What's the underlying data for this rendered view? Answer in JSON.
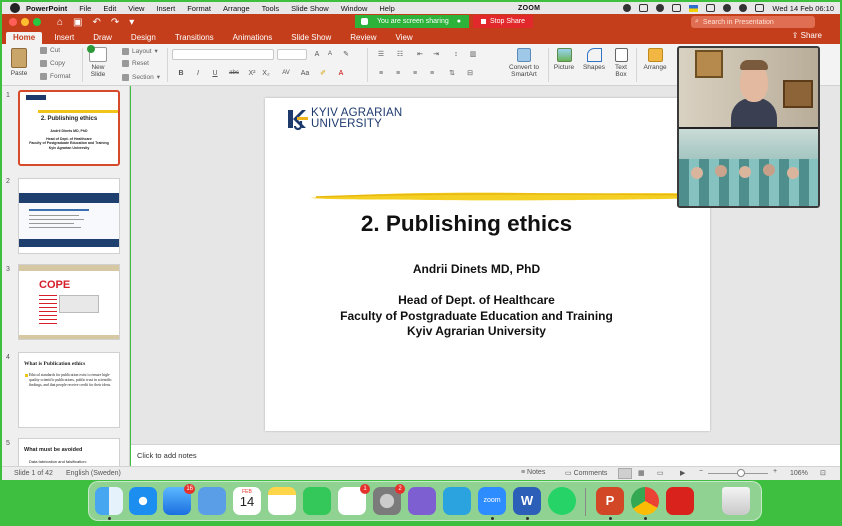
{
  "menubar": {
    "app": "PowerPoint",
    "items": [
      "File",
      "Edit",
      "View",
      "Insert",
      "Format",
      "Arrange",
      "Tools",
      "Slide Show",
      "Window",
      "Help"
    ],
    "zoom_label": "ZOOM",
    "clock": "Wed 14 Feb  06:10"
  },
  "titlebar": {
    "screen_sharing": "You are screen sharing",
    "stop_share": "Stop Share",
    "search_placeholder": "Search in Presentation"
  },
  "tabs": [
    "Home",
    "Insert",
    "Draw",
    "Design",
    "Transitions",
    "Animations",
    "Slide Show",
    "Review",
    "View"
  ],
  "active_tab": "Home",
  "share_label": "Share",
  "ribbon": {
    "paste": "Paste",
    "cut": "Cut",
    "copy": "Copy",
    "format": "Format",
    "new_slide": "New Slide",
    "layout": "Layout",
    "reset": "Reset",
    "section": "Section",
    "convert": "Convert to SmartArt",
    "picture": "Picture",
    "shapes": "Shapes",
    "text_box": "Text Box",
    "arrange": "Arrange",
    "bold": "B",
    "italic": "I",
    "underline": "U",
    "strike": "abc",
    "sup": "X²",
    "sub": "X₂",
    "char_spacing": "AV",
    "case": "Aa",
    "font_grow": "A",
    "font_shrink": "A"
  },
  "thumbnails": [
    {
      "number": "1",
      "title": "2. Publishing ethics",
      "lines": [
        "Andrii Dinets MD, PhD",
        "Head of Dept. of Healthcare",
        "Faculty of Postgraduate Education and Training",
        "Kyiv Agrarian University"
      ]
    },
    {
      "number": "2"
    },
    {
      "number": "3",
      "title": "COPE"
    },
    {
      "number": "4",
      "title": "What is Publication ethics",
      "body": "Ethical standards for publication exist to ensure high-quality scientific publications, public trust in scientific findings, and that people receive credit for their ideas."
    },
    {
      "number": "5",
      "title": "What must be avoided",
      "body": "Data fabrication and falsification:"
    }
  ],
  "slide": {
    "logo_line1": "KYIV AGRARIAN",
    "logo_line2": "UNIVERSITY",
    "title": "2. Publishing ethics",
    "author": "Andrii Dinets MD, PhD",
    "affiliation": [
      "Head of Dept. of Healthcare",
      "Faculty of Postgraduate Education and Training",
      "Kyiv Agrarian University"
    ]
  },
  "notes_placeholder": "Click to add notes",
  "status": {
    "slide_info": "Slide 1 of 42",
    "language": "English (Sweden)",
    "notes": "Notes",
    "comments": "Comments",
    "zoom": "106%"
  },
  "dock": {
    "mail_badge": "16",
    "calendar_month": "FEB",
    "calendar_day": "14",
    "reminders_badge": "1",
    "settings_badge": "2",
    "zoom_app": "zoom",
    "word": "W",
    "powerpoint": "P"
  },
  "colors": {
    "ppt_accent": "#c43e1c",
    "share_green": "#2db33a",
    "stop_red": "#e1292b",
    "desktop_border": "#3fbf3f"
  }
}
